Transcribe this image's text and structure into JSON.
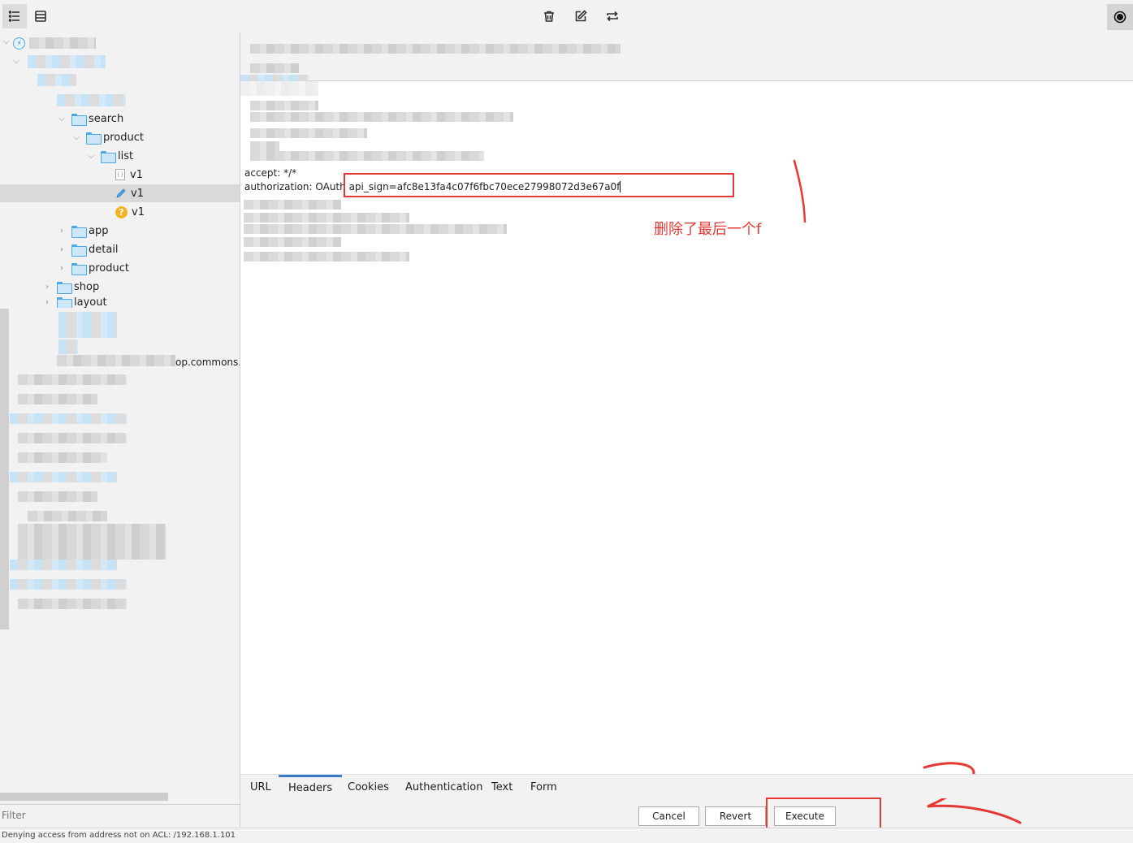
{
  "toolbar": {
    "icons": [
      "tree-view-icon",
      "list-view-icon",
      "trash-icon",
      "edit-icon",
      "repeat-icon",
      "record-icon"
    ]
  },
  "sidebar": {
    "tree": [
      {
        "label": "search",
        "kind": "folder",
        "expanded": true
      },
      {
        "label": "product",
        "kind": "folder",
        "expanded": true
      },
      {
        "label": "list",
        "kind": "folder",
        "expanded": true
      },
      {
        "label": "v1",
        "kind": "file"
      },
      {
        "label": "v1",
        "kind": "edited",
        "selected": true
      },
      {
        "label": "v1",
        "kind": "pending"
      },
      {
        "label": "app",
        "kind": "folder",
        "expanded": false
      },
      {
        "label": "detail",
        "kind": "folder",
        "expanded": false
      },
      {
        "label": "product",
        "kind": "folder",
        "expanded": false
      },
      {
        "label": "shop",
        "kind": "folder",
        "expanded": false
      },
      {
        "label": "layout",
        "kind": "folder",
        "expanded": false
      }
    ],
    "truncated_host": "op.commons.c",
    "filter_placeholder": "Filter"
  },
  "editor": {
    "header_lines": {
      "accept": "accept: */*",
      "authorization_prefix": "authorization: OAuth ",
      "authorization_value": "api_sign=afc8e13fa4c07f6fbc70ece27998072d3e67a0f"
    },
    "annotation": "删除了最后一个f",
    "highlight_color": "#e53935"
  },
  "tabs": [
    {
      "label": "URL",
      "active": false
    },
    {
      "label": "Headers",
      "active": true
    },
    {
      "label": "Cookies",
      "active": false
    },
    {
      "label": "Authentication",
      "active": false
    },
    {
      "label": "Text",
      "active": false
    },
    {
      "label": "Form",
      "active": false
    }
  ],
  "actions": {
    "cancel": "Cancel",
    "revert": "Revert",
    "execute": "Execute"
  },
  "status": {
    "message": "Denying access from address not on ACL: /192.168.1.101"
  },
  "colors": {
    "accent": "#3a7ec9",
    "folder": "#4ea8e6",
    "annotation": "#e53935"
  }
}
